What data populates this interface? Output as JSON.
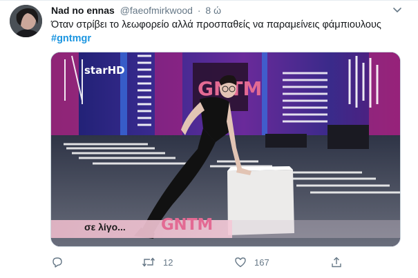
{
  "tweet": {
    "display_name": "Nad no ennas",
    "handle": "@faeofmirkwood",
    "separator": "·",
    "time": "8 ώ",
    "text": "Όταν στρίβει το λεωφορείο αλλά προσπαθείς να παραμείνεις φάμπιουλους",
    "hashtag": "#gntmgr"
  },
  "media": {
    "channel_logo": "starHD",
    "banner_text": "σε λίγο...",
    "banner_logo": "GNTM",
    "backdrop_logo": "GNTM"
  },
  "actions": {
    "reply_count": "",
    "retweet_count": "12",
    "like_count": "167"
  },
  "icons": {
    "more": "chevron-down-icon",
    "reply": "reply-icon",
    "retweet": "retweet-icon",
    "like": "heart-icon",
    "share": "share-icon"
  },
  "colors": {
    "link": "#1b95e0",
    "secondary_text": "#657786",
    "banner_pink": "#e36a93"
  }
}
